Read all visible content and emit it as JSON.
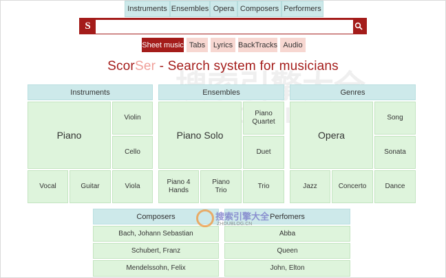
{
  "top_nav": [
    "Instruments",
    "Ensembles",
    "Opera",
    "Composers",
    "Performers"
  ],
  "search": {
    "logo": "S",
    "placeholder": ""
  },
  "sub_tabs": [
    "Sheet music",
    "Tabs",
    "Lyrics",
    "BackTracks",
    "Audio"
  ],
  "title": {
    "brand_main": "Scor",
    "brand_accent": "Ser",
    "rest": " - Search system for musicians"
  },
  "instruments": {
    "header": "Instruments",
    "big": "Piano",
    "right": [
      "Violin",
      "Cello"
    ],
    "bottom": [
      "Vocal",
      "Guitar",
      "Viola"
    ]
  },
  "ensembles": {
    "header": "Ensembles",
    "big": "Piano Solo",
    "right": [
      "Piano Quartet",
      "Duet"
    ],
    "bottom": [
      "Piano 4 Hands",
      "Piano Trio",
      "Trio"
    ]
  },
  "genres": {
    "header": "Genres",
    "big": "Opera",
    "right": [
      "Song",
      "Sonata"
    ],
    "bottom": [
      "Jazz",
      "Concerto",
      "Dance"
    ]
  },
  "composers": {
    "header": "Composers",
    "items": [
      "Bach, Johann Sebastian",
      "Schubert, Franz",
      "Mendelssohn, Felix"
    ]
  },
  "performers": {
    "header": "Perfomers",
    "items": [
      "Abba",
      "Queen",
      "John, Elton"
    ]
  },
  "watermark": {
    "text_cn": "搜索引擎大全",
    "text_en": "ZHOUBLOG.CN"
  }
}
